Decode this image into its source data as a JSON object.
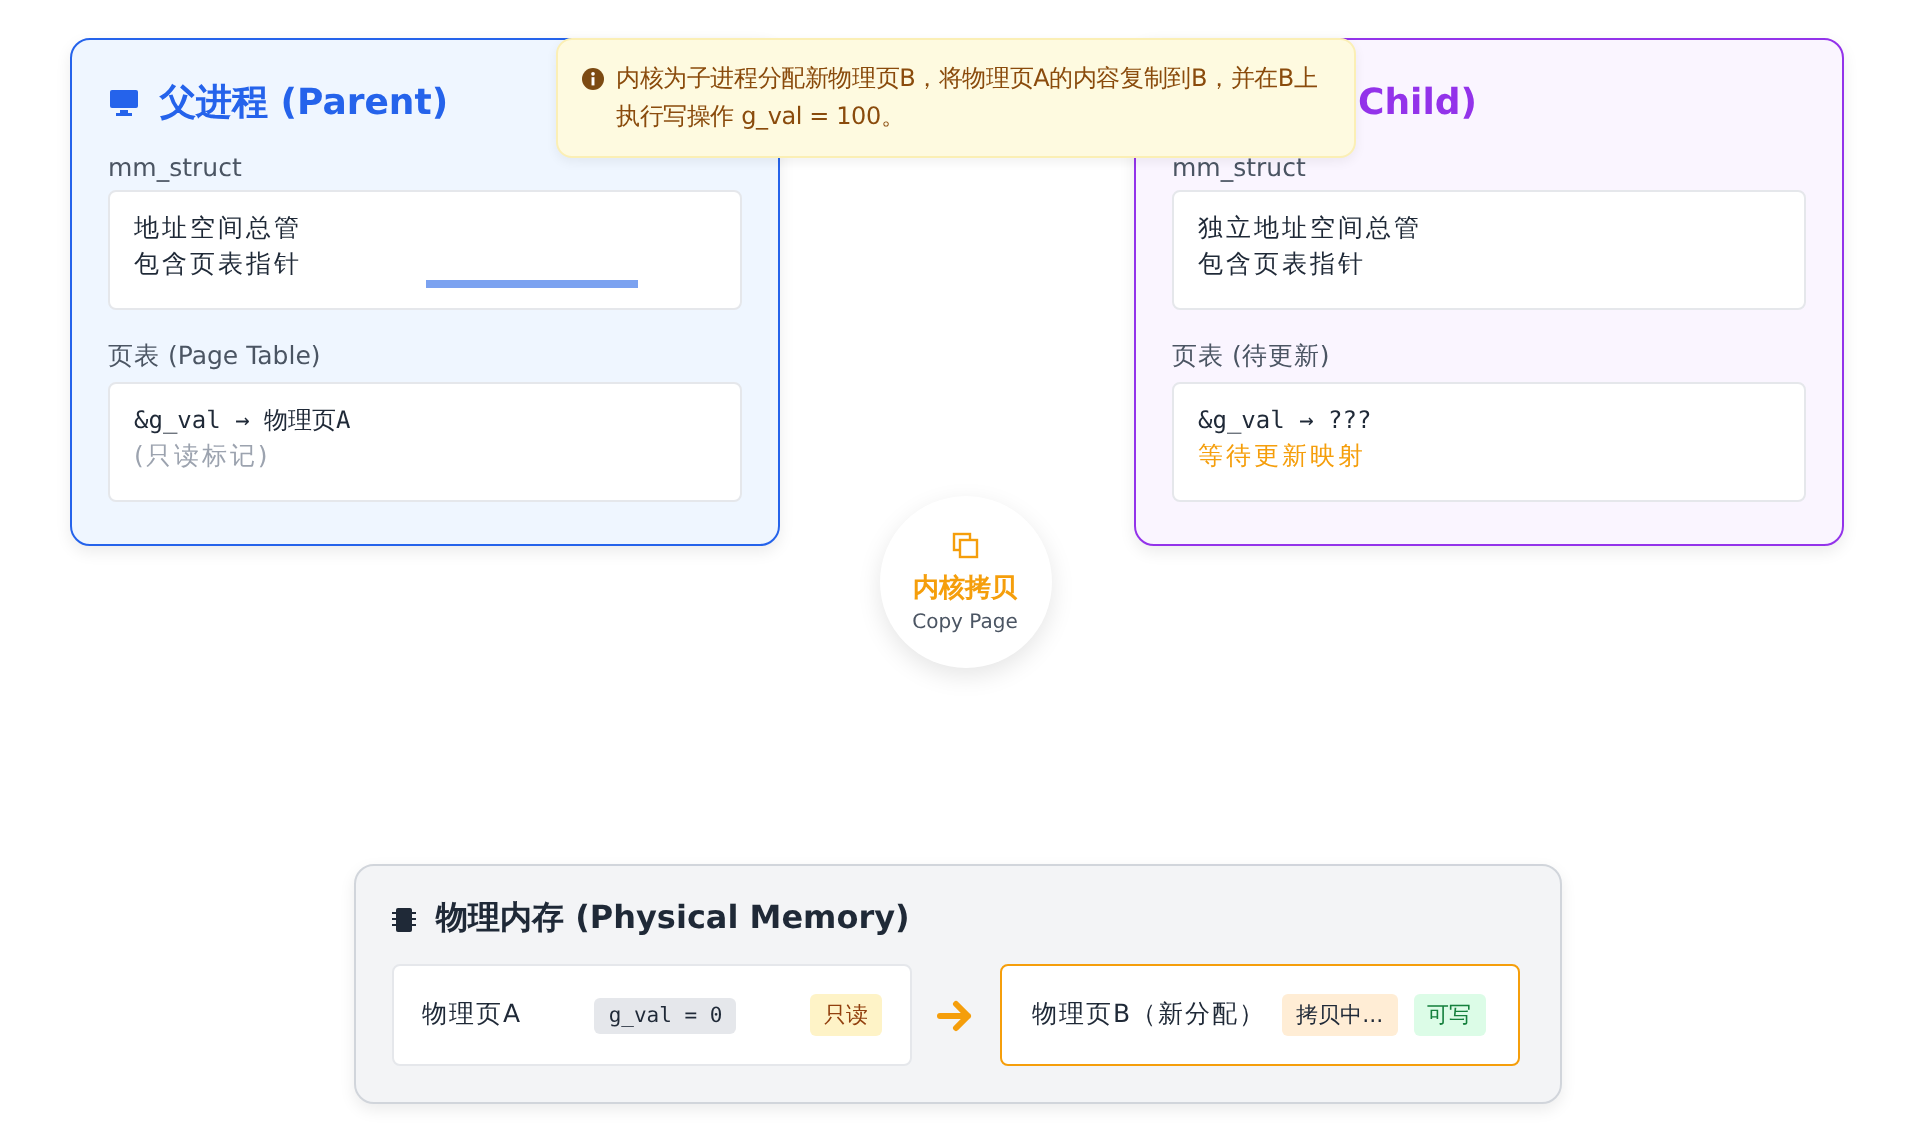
{
  "tooltip": {
    "text": "内核为子进程分配新物理页B，将物理页A的内容复制到B，并在B上执行写操作 g_val = 100。"
  },
  "processes": [
    {
      "kind": "parent",
      "title": "父进程 (Parent)",
      "mm_label": "mm_struct",
      "mm_lines": [
        "地址空间总管",
        "包含页表指针"
      ],
      "pt_label": "页表 (Page Table)",
      "pt_entry": "&g_val → 物理页A",
      "pt_note": "(只读标记)"
    },
    {
      "kind": "child",
      "title": "Child)",
      "mm_label": "mm_struct",
      "mm_lines": [
        "独立地址空间总管",
        "包含页表指针"
      ],
      "pt_label": "页表 (待更新)",
      "pt_entry": "&g_val → ???",
      "pt_note": "等待更新映射"
    }
  ],
  "copy_node": {
    "title": "内核拷贝",
    "subtitle": "Copy Page"
  },
  "memory": {
    "title": "物理内存 (Physical Memory)",
    "pages": [
      {
        "kind": "source",
        "name": "物理页A",
        "tags": [
          {
            "kind": "value",
            "text": "g_val = 0"
          },
          {
            "kind": "readonly",
            "text": "只读"
          }
        ]
      },
      {
        "kind": "target",
        "name": "物理页B（新分配）",
        "tags": [
          {
            "kind": "copying",
            "text": "拷贝中..."
          },
          {
            "kind": "writable",
            "text": "可写"
          }
        ]
      }
    ]
  }
}
